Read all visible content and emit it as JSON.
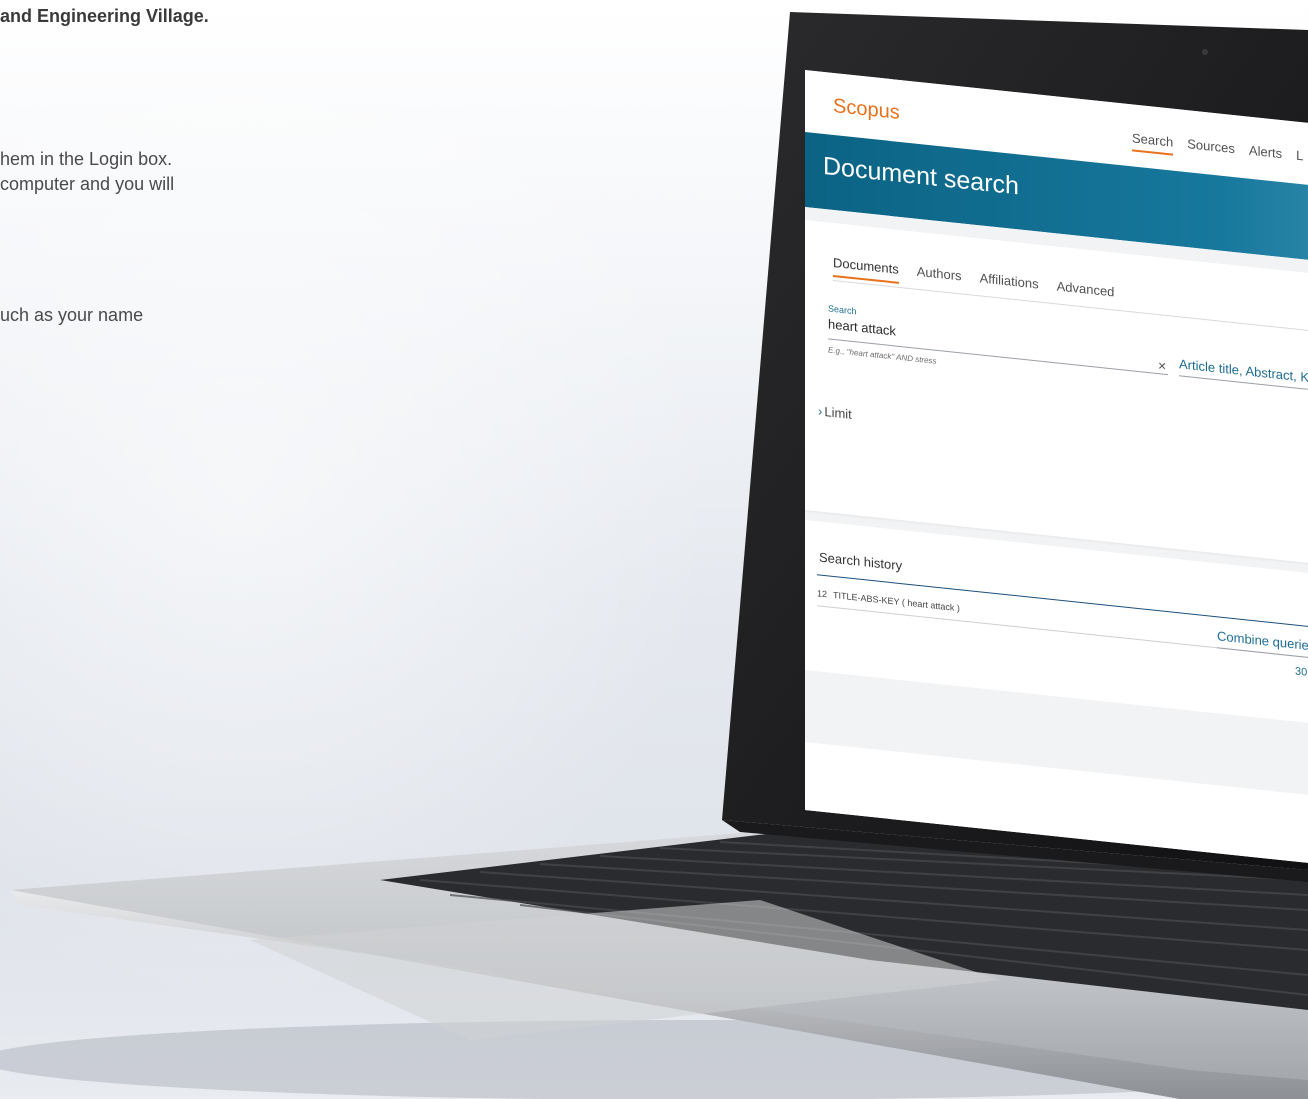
{
  "page_text": {
    "header": "and Engineering Village.",
    "line1": "hem in the Login box.",
    "line2": "computer and you will",
    "line3": "uch as your name"
  },
  "app": {
    "logo": "Scopus",
    "nav": [
      "Search",
      "Sources",
      "Alerts",
      "L"
    ],
    "page_title": "Document search"
  },
  "search": {
    "tabs": [
      "Documents",
      "Authors",
      "Affiliations",
      "Advanced"
    ],
    "active_tab": "Documents",
    "label": "Search",
    "value": "heart attack",
    "hint": "E.g., \"heart attack\" AND stress",
    "field_select": "Article title, Abstract, K",
    "clear_glyph": "×",
    "limit_label": "Limit"
  },
  "history": {
    "title": "Search history",
    "combine_label": "Combine querie",
    "rows": [
      {
        "num": "12",
        "query": "TITLE-ABS-KEY ( heart  attack )",
        "count": "30"
      }
    ]
  },
  "colors": {
    "accent_orange": "#e9711c",
    "banner_blue": "#0b6384",
    "link_blue": "#1d6c92"
  }
}
